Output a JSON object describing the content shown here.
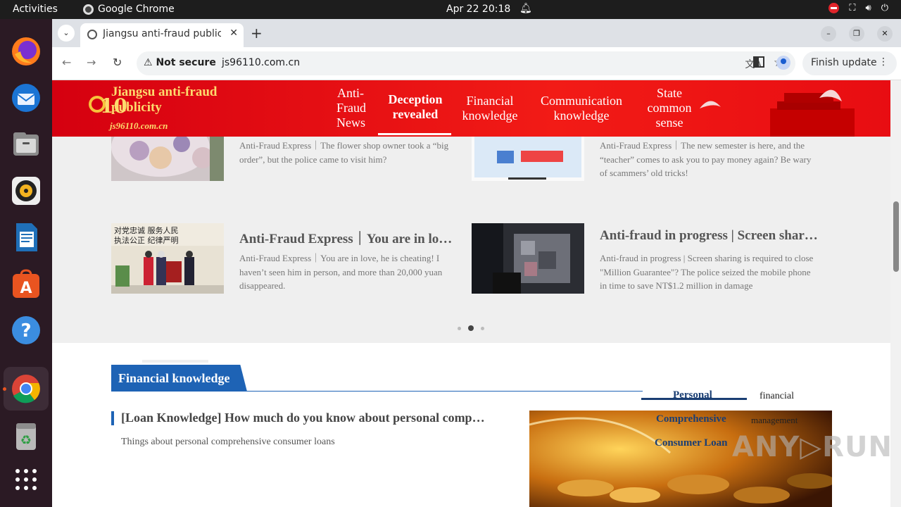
{
  "system": {
    "activities": "Activities",
    "app_name": "Google Chrome",
    "clock": "Apr 22  20:18"
  },
  "browser": {
    "tab_title": "Jiangsu anti-fraud public",
    "security_label": "Not secure",
    "url": "js96110.com.cn",
    "finish_update": "Finish update"
  },
  "site": {
    "logo_text": "Jiangsu anti-fraud publicity",
    "logo_url": "js96110.com.cn",
    "nav": [
      {
        "label": "Anti-\nFraud\nNews"
      },
      {
        "label": "Deception revealed",
        "active": true
      },
      {
        "label": "Financial knowledge"
      },
      {
        "label": "Communication knowledge"
      },
      {
        "label": "State common sense"
      }
    ]
  },
  "news": [
    {
      "title": "",
      "desc": "Anti-Fraud Express｜The flower shop owner took a “big order”, but the police came to visit him?"
    },
    {
      "title": "",
      "desc": "Anti-Fraud Express｜The new semester is here, and the “teacher” comes to ask you to pay money again? Be wary of scammers’ old tricks!"
    },
    {
      "title": "Anti-Fraud Express｜You are in love, he is cheating!",
      "desc": "Anti-Fraud Express｜You are in love, he is cheating! I haven’t seen him in person, and more than 20,000 yuan disappeared."
    },
    {
      "title": "Anti-fraud in progress | Screen sharing is required",
      "desc": "Anti-fraud in progress | Screen sharing is required to close \"Million Guarantee\"? The police seized the mobile phone in time to save NT$1.2 million in damage"
    }
  ],
  "carousel": {
    "pages": 3,
    "current": 2
  },
  "finance": {
    "heading": "Financial knowledge",
    "article_title": "[Loan Knowledge] How much do you know about personal comprehensive consumer loans",
    "article_desc": "Things about personal comprehensive consumer loans",
    "tabs": {
      "personal": "Personal",
      "comprehensive": "Comprehensive",
      "consumer_loan": "Consumer Loan",
      "financial": "financial",
      "management": "management"
    }
  },
  "watermark": "ANY▷RUN",
  "colors": {
    "header_red": "#e80d12",
    "logo_gold": "#fddb6d",
    "accent_blue": "#1e63b5",
    "band_gray": "#efefef"
  }
}
